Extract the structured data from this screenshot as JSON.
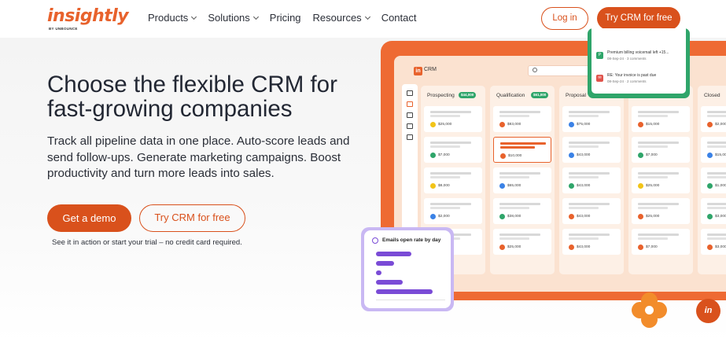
{
  "brand": {
    "name": "insightly",
    "sub": "BY UNBOUNCE",
    "accent": "#d9511c"
  },
  "nav": {
    "items": [
      {
        "label": "Products",
        "dropdown": true
      },
      {
        "label": "Solutions",
        "dropdown": true
      },
      {
        "label": "Pricing",
        "dropdown": false
      },
      {
        "label": "Resources",
        "dropdown": true
      },
      {
        "label": "Contact",
        "dropdown": false
      }
    ],
    "login_label": "Log in",
    "try_label": "Try CRM for free"
  },
  "hero": {
    "headline": "Choose the flexible CRM for fast-growing companies",
    "subtext": "Track all pipeline data in one place. Auto-score leads and send follow-ups. Generate marketing campaigns. Boost productivity and turn more leads into sales.",
    "demo_label": "Get a demo",
    "try_label": "Try CRM for free",
    "note": "See it in action or start your trial – no credit card required."
  },
  "crm": {
    "app_label": "CRM",
    "columns": [
      {
        "title": "Prospecting",
        "pill": "$44,000",
        "cards": [
          {
            "amount": "$25,000",
            "color": "#f2c418"
          },
          {
            "amount": "$7,000",
            "color": "#2fa56a"
          },
          {
            "amount": "$8,000",
            "color": "#f2c418"
          },
          {
            "amount": "$2,000",
            "color": "#3b82e6"
          },
          {
            "amount": "",
            "color": ""
          }
        ]
      },
      {
        "title": "Qualification",
        "pill": "$61,000",
        "cards": [
          {
            "amount": "$83,000",
            "color": "#e8622c"
          },
          {
            "amount": "$10,000",
            "color": "#e8622c",
            "highlight": true
          },
          {
            "amount": "$65,000",
            "color": "#3b82e6"
          },
          {
            "amount": "$38,000",
            "color": "#2fa56a"
          },
          {
            "amount": "$25,000",
            "color": "#e8622c"
          }
        ]
      },
      {
        "title": "Proposal",
        "pill": "",
        "cards": [
          {
            "amount": "$75,000",
            "color": "#3b82e6"
          },
          {
            "amount": "$43,000",
            "color": "#3b82e6"
          },
          {
            "amount": "$43,000",
            "color": "#2fa56a"
          },
          {
            "amount": "$43,000",
            "color": "#e8622c"
          },
          {
            "amount": "$43,000",
            "color": "#e8622c"
          }
        ]
      },
      {
        "title": "",
        "pill": "",
        "cards": [
          {
            "amount": "$15,000",
            "color": "#e8622c"
          },
          {
            "amount": "$7,000",
            "color": "#2fa56a"
          },
          {
            "amount": "$25,000",
            "color": "#f2c418"
          },
          {
            "amount": "$25,000",
            "color": "#e8622c"
          },
          {
            "amount": "$7,000",
            "color": "#e8622c"
          }
        ]
      },
      {
        "title": "",
        "pill": "",
        "cards": [
          {
            "amount": "",
            "color": ""
          },
          {
            "amount": "",
            "color": ""
          },
          {
            "amount": "",
            "color": ""
          },
          {
            "amount": "",
            "color": ""
          },
          {
            "amount": "",
            "color": ""
          }
        ]
      },
      {
        "title": "Closed",
        "pill": "",
        "cards": [
          {
            "amount": "$2,000",
            "color": "#e8622c"
          },
          {
            "amount": "$15,000",
            "color": "#3b82e6"
          },
          {
            "amount": "$1,000",
            "color": "#2fa56a"
          },
          {
            "amount": "$3,000",
            "color": "#2fa56a"
          },
          {
            "amount": "$3,000",
            "color": "#e8622c"
          }
        ]
      }
    ]
  },
  "notifications": [
    {
      "title": "Premium billing voicemail left +15...",
      "sub": "08-Sep-24 · 3 comments",
      "color": "#2fa56a",
      "glyph": "P"
    },
    {
      "title": "RE: Your invoice is past due",
      "sub": "08-Sep-24 · 2 comments",
      "color": "#e0534b",
      "glyph": "✉"
    }
  ],
  "emails_chart": {
    "title": "Emails open rate by day",
    "icon": "mail-icon",
    "values": [
      0.55,
      0.28,
      0.08,
      0.42,
      0.88
    ],
    "color": "#7a4bd6"
  },
  "chat": {
    "label": "in"
  }
}
